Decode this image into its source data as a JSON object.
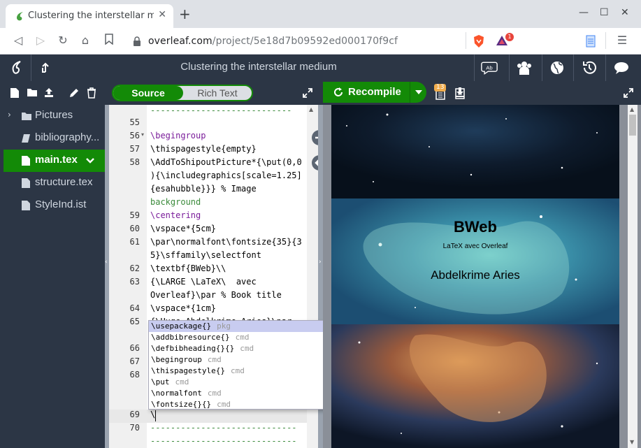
{
  "browser": {
    "tab_title": "Clustering the interstellar medium",
    "url_host": "overleaf.com",
    "url_path": "/project/5e18d7b09592ed000170f9cf",
    "extension_badge": "1"
  },
  "overleaf": {
    "project_title": "Clustering the interstellar medium",
    "toggle": {
      "source": "Source",
      "rich_text": "Rich Text"
    },
    "recompile": "Recompile",
    "log_badge": "13"
  },
  "filetree": {
    "items": [
      {
        "label": "Pictures",
        "type": "folder"
      },
      {
        "label": "bibliography...",
        "type": "bib"
      },
      {
        "label": "main.tex",
        "type": "file",
        "selected": true
      },
      {
        "label": "structure.tex",
        "type": "file"
      },
      {
        "label": "StyleInd.ist",
        "type": "file"
      }
    ]
  },
  "editor": {
    "line_numbers": [
      "55",
      "56",
      "57",
      "58",
      "59",
      "60",
      "61",
      "62",
      "63",
      "64",
      "65",
      "66",
      "67",
      "68",
      "69",
      "70"
    ],
    "lines": [
      "----------------------------",
      "",
      "\\begingroup",
      "\\thispagestyle{empty}",
      "\\AddToShipoutPicture*{\\put(0,0",
      "){\\includegraphics[scale=1.25]",
      "{esahubble}}} % Image",
      "background",
      "\\centering",
      "\\vspace*{5cm}",
      "\\par\\normalfont\\fontsize{35}{3",
      "5}\\sffamily\\selectfont",
      "\\textbf{BWeb}\\\\",
      "{\\LARGE \\LaTeX\\  avec",
      "Overleaf}\\par % Book title",
      "\\vspace*{1cm}",
      "{\\Huge Abdelkrime Aries}\\par",
      "-----------------------------",
      "-----------------------------"
    ],
    "current_line_text": "\\"
  },
  "autocomplete": {
    "items": [
      {
        "text": "\\usepackage{}",
        "meta": "pkg"
      },
      {
        "text": "\\addbibresource{}",
        "meta": "cmd"
      },
      {
        "text": "\\defbibheading{}{}",
        "meta": "cmd"
      },
      {
        "text": "\\begingroup",
        "meta": "cmd"
      },
      {
        "text": "\\thispagestyle{}",
        "meta": "cmd"
      },
      {
        "text": "\\put",
        "meta": "cmd"
      },
      {
        "text": "\\normalfont",
        "meta": "cmd"
      },
      {
        "text": "\\fontsize{}{}",
        "meta": "cmd"
      }
    ]
  },
  "pdf": {
    "title": "BWeb",
    "subtitle": "LaTeX avec Overleaf",
    "author": "Abdelkrime Aries"
  },
  "colors": {
    "overleaf_green": "#138a07",
    "overleaf_dark": "#2c3645"
  }
}
